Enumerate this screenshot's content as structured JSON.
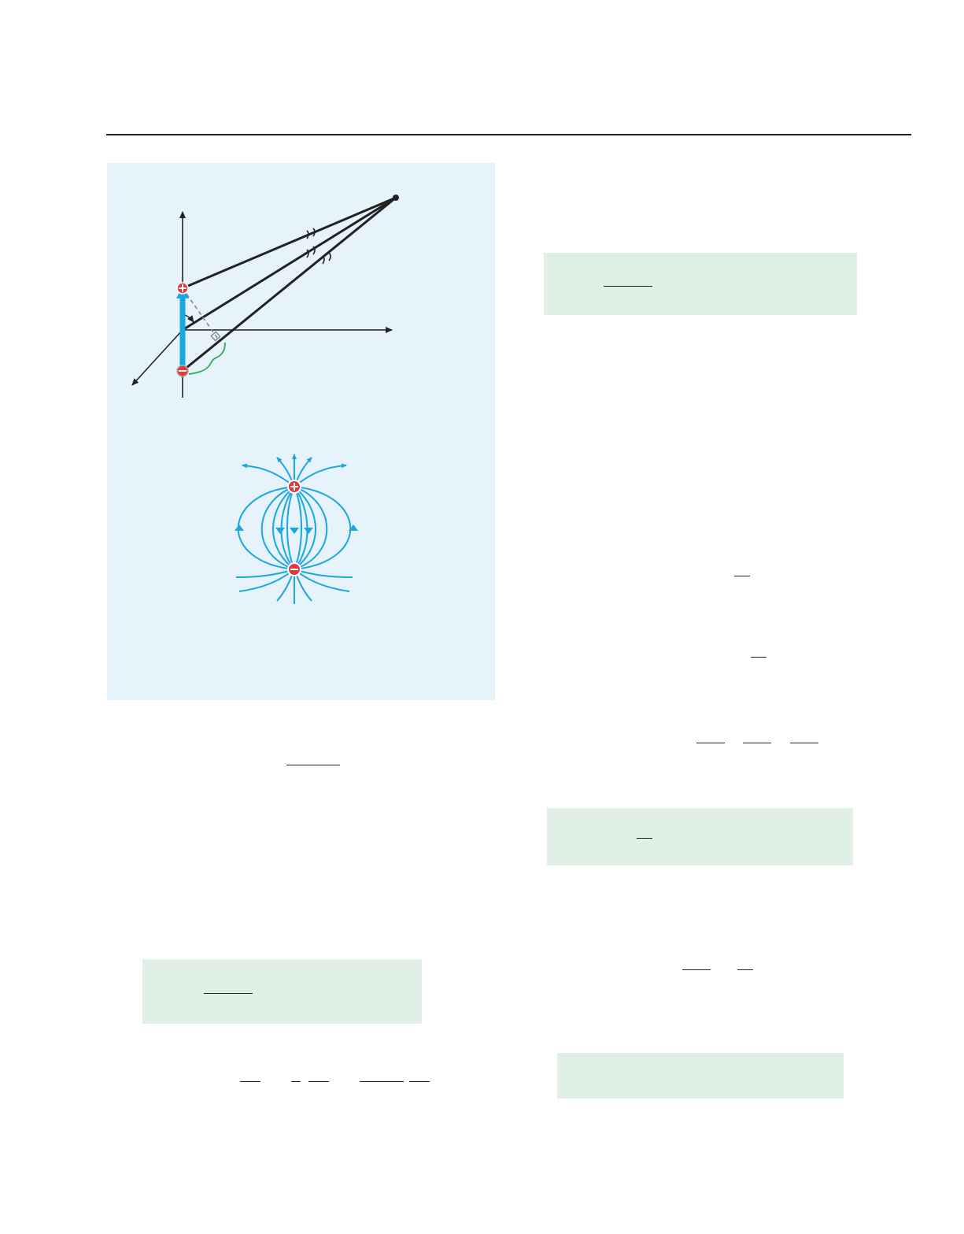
{
  "figure": {
    "line_color": "#222222",
    "dipole_arrow_color": "#1aa6e0",
    "bracket_color": "#2eab5a",
    "field_line_color": "#1aa6e0",
    "positive_charge_icon": "plus-charge-icon",
    "negative_charge_icon": "minus-charge-icon"
  }
}
